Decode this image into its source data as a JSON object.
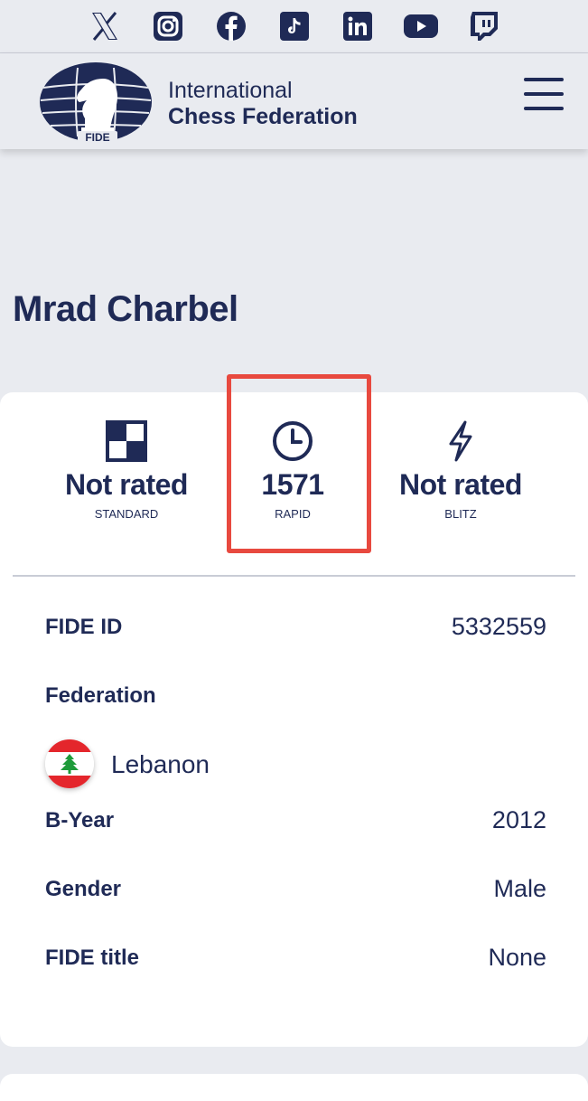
{
  "social": [
    "x-icon",
    "instagram-icon",
    "facebook-icon",
    "tiktok-icon",
    "linkedin-icon",
    "youtube-icon",
    "twitch-icon"
  ],
  "brand": {
    "logo_text": "FIDE",
    "line1": "International",
    "line2": "Chess Federation"
  },
  "player": {
    "name": "Mrad Charbel"
  },
  "ratings": {
    "standard": {
      "value": "Not rated",
      "label": "STANDARD"
    },
    "rapid": {
      "value": "1571",
      "label": "RAPID"
    },
    "blitz": {
      "value": "Not rated",
      "label": "BLITZ"
    }
  },
  "details": {
    "fide_id_label": "FIDE ID",
    "fide_id": "5332559",
    "federation_label": "Federation",
    "federation": "Lebanon",
    "byear_label": "B-Year",
    "byear": "2012",
    "gender_label": "Gender",
    "gender": "Male",
    "title_label": "FIDE title",
    "title": "None"
  },
  "colors": {
    "navy": "#1f2a56",
    "highlight": "#e8493f",
    "background": "#e9ebf0"
  }
}
